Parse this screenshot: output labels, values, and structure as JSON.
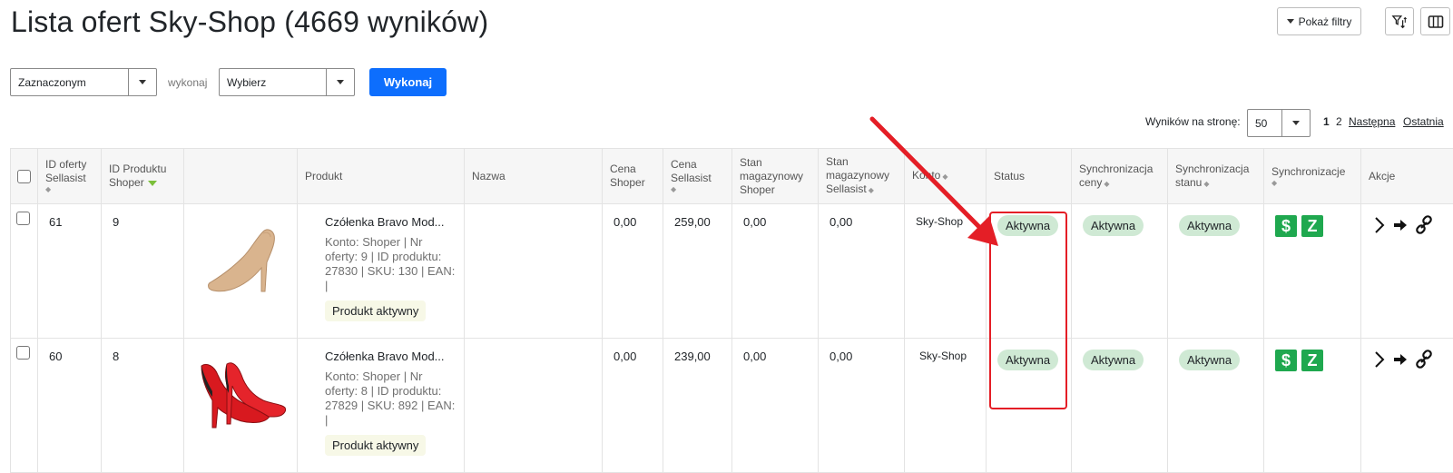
{
  "page": {
    "title": "Lista ofert Sky-Shop (4669 wyników)"
  },
  "toolbar": {
    "show_filters": "Pokaż filtry",
    "filter_sort_icon": "filter-sort-icon",
    "columns_icon": "columns-icon"
  },
  "bulk": {
    "scope_value": "Zaznaczonym",
    "action_label": "wykonaj",
    "action_value": "Wybierz",
    "execute_button": "Wykonaj"
  },
  "pagination": {
    "per_page_label": "Wyników na stronę:",
    "per_page_value": "50",
    "current_page": "1",
    "next_page_number": "2",
    "next_label": "Następna",
    "last_label": "Ostatnia"
  },
  "table": {
    "headers": {
      "offer_id": "ID oferty Sellasist",
      "product_id": "ID Produktu Shoper",
      "product": "Produkt",
      "name": "Nazwa",
      "price_shoper": "Cena Shoper",
      "price_sellasist": "Cena Sellasist",
      "stock_shoper": "Stan magazynowy Shoper",
      "stock_sellasist": "Stan magazynowy Sellasist",
      "account": "Konto",
      "status": "Status",
      "sync_price": "Synchronizacja ceny",
      "sync_stock": "Synchronizacja stanu",
      "syncs": "Synchronizacje",
      "actions": "Akcje"
    },
    "rows": [
      {
        "offer_id": "61",
        "product_id": "9",
        "product_name": "Czółenka Bravo Mod...",
        "product_meta": "Konto: Shoper | Nr oferty: 9 | ID produktu: 27830 | SKU: 130 | EAN: |",
        "product_badge": "Produkt aktywny",
        "name": "",
        "price_shoper": "0,00",
        "price_sellasist": "259,00",
        "stock_shoper": "0,00",
        "stock_sellasist": "0,00",
        "account": "Sky-Shop",
        "status": "Aktywna",
        "sync_price": "Aktywna",
        "sync_stock": "Aktywna",
        "image": "beige-heel-shoe"
      },
      {
        "offer_id": "60",
        "product_id": "8",
        "product_name": "Czółenka Bravo Mod...",
        "product_meta": "Konto: Shoper | Nr oferty: 8 | ID produktu: 27829 | SKU: 892 | EAN: |",
        "product_badge": "Produkt aktywny",
        "name": "",
        "price_shoper": "0,00",
        "price_sellasist": "239,00",
        "stock_shoper": "0,00",
        "stock_sellasist": "0,00",
        "account": "Sky-Shop",
        "status": "Aktywna",
        "sync_price": "Aktywna",
        "sync_stock": "Aktywna",
        "image": "red-heel-shoe"
      }
    ]
  },
  "colors": {
    "primary": "#0d6efd",
    "status_badge": "#cfe9d4",
    "sync_icon": "#1fa84f",
    "annotation": "#e41e26"
  }
}
